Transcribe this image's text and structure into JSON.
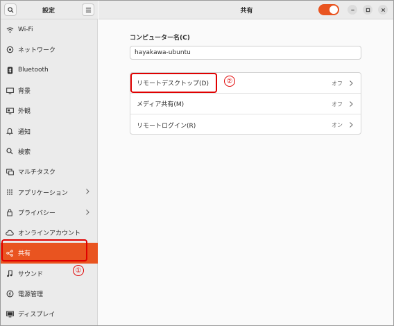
{
  "colors": {
    "accent": "#e95420",
    "annotation": "#e00000"
  },
  "sidebar": {
    "title": "設定",
    "search_icon": "search-icon",
    "menu_icon": "hamburger-menu-icon",
    "items": [
      {
        "label": "Wi-Fi",
        "icon": "wifi-icon"
      },
      {
        "label": "ネットワーク",
        "icon": "network-icon"
      },
      {
        "label": "Bluetooth",
        "icon": "bluetooth-icon"
      },
      {
        "label": "背景",
        "icon": "background-icon"
      },
      {
        "label": "外観",
        "icon": "appearance-icon"
      },
      {
        "label": "通知",
        "icon": "bell-icon"
      },
      {
        "label": "検索",
        "icon": "search-icon"
      },
      {
        "label": "マルチタスク",
        "icon": "multitask-icon"
      },
      {
        "label": "アプリケーション",
        "icon": "apps-grid-icon",
        "chevron": true
      },
      {
        "label": "プライバシー",
        "icon": "lock-icon",
        "chevron": true
      },
      {
        "label": "オンラインアカウント",
        "icon": "cloud-icon"
      },
      {
        "label": "共有",
        "icon": "share-icon",
        "active": true
      },
      {
        "label": "サウンド",
        "icon": "music-note-icon"
      },
      {
        "label": "電源管理",
        "icon": "power-icon"
      },
      {
        "label": "ディスプレイ",
        "icon": "display-icon"
      }
    ],
    "annotation": "①"
  },
  "header": {
    "title": "共有",
    "toggle_on": true
  },
  "main": {
    "computer_name_label": "コンピューター名(C)",
    "computer_name_value": "hayakawa-ubuntu",
    "rows": [
      {
        "label": "リモートデスクトップ(D)",
        "status": "オフ"
      },
      {
        "label": "メディア共有(M)",
        "status": "オフ"
      },
      {
        "label": "リモートログイン(R)",
        "status": "オン"
      }
    ],
    "annotation": "②"
  }
}
